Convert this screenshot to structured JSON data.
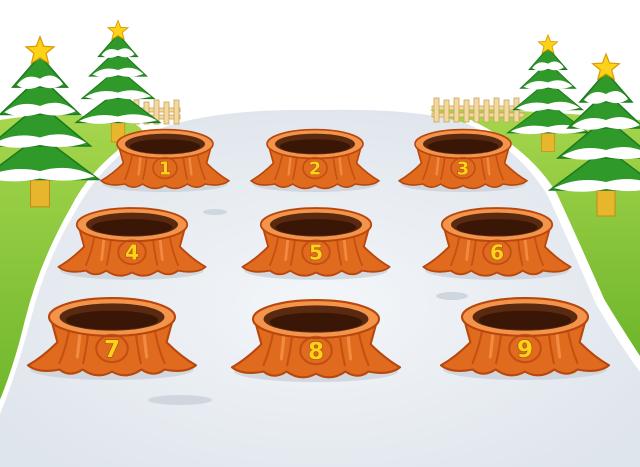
{
  "game": {
    "stumps": [
      {
        "id": 1,
        "label": "1"
      },
      {
        "id": 2,
        "label": "2"
      },
      {
        "id": 3,
        "label": "3"
      },
      {
        "id": 4,
        "label": "4"
      },
      {
        "id": 5,
        "label": "5"
      },
      {
        "id": 6,
        "label": "6"
      },
      {
        "id": 7,
        "label": "7"
      },
      {
        "id": 8,
        "label": "8"
      },
      {
        "id": 9,
        "label": "9"
      }
    ]
  },
  "colors": {
    "ice": "#e9edf2",
    "snow": "#ffffff",
    "grass": "#8fc63c",
    "grass_dark": "#5ea51f",
    "tree": "#2f9a2a",
    "tree_dark": "#1f7a1f",
    "trunk": "#e8b62c",
    "stump": "#e06a1e",
    "stump_dark": "#b8470d",
    "stump_light": "#f4944a",
    "hole": "#5a2a10",
    "hole_dark": "#3a1606",
    "number": "#ffd21a",
    "number_outline": "#a3500c",
    "fence": "#f3d9a0",
    "star": "#ffd21a"
  },
  "icons": {
    "tree": "christmas-tree-icon",
    "star": "star-icon",
    "fence": "fence-icon"
  }
}
